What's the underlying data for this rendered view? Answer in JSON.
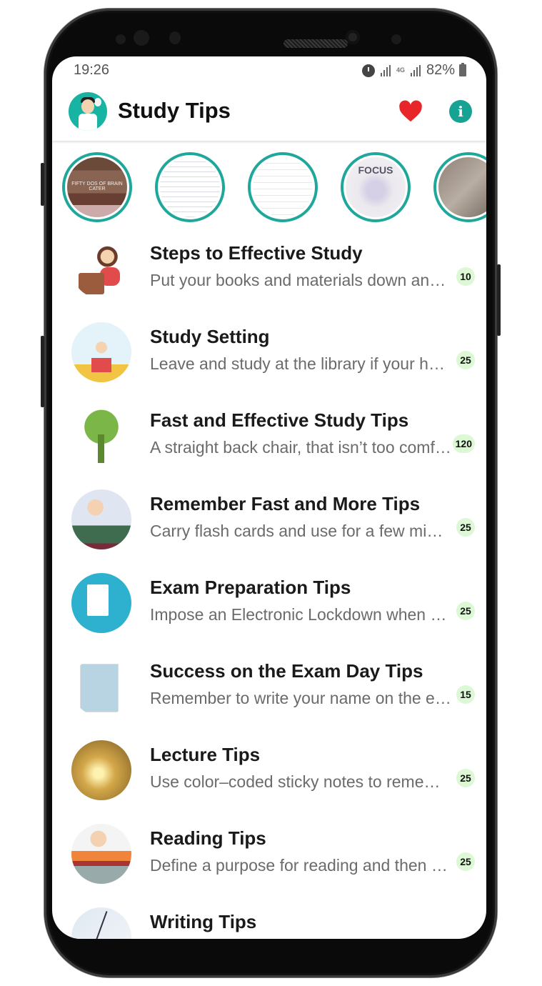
{
  "status_bar": {
    "time": "19:26",
    "network_label": "4G",
    "battery_percent": "82%",
    "icons": [
      "alarm-icon",
      "signal-icon",
      "4g-icon",
      "signal-icon",
      "battery-charging-icon"
    ]
  },
  "app_bar": {
    "title": "Study Tips",
    "actions": [
      {
        "name": "favorites",
        "icon": "heart-icon",
        "color": "#e8262a"
      },
      {
        "name": "info",
        "icon": "info-icon",
        "glyph": "i",
        "color": "#16a394"
      }
    ]
  },
  "stories": [
    {
      "caption": "FIFTY DOS OF BRAIN CATER"
    },
    {
      "caption": ""
    },
    {
      "caption": ""
    },
    {
      "caption": "FOCUS"
    },
    {
      "caption": ""
    }
  ],
  "accent_color": "#1fa79b",
  "badge_color": "#dcf8d4",
  "items": [
    {
      "title": "Steps to Effective Study",
      "subtitle": "Put your books and materials down and settle in",
      "count": "10"
    },
    {
      "title": "Study Setting",
      "subtitle": "Leave and study at the library if your home is noisy",
      "count": "25"
    },
    {
      "title": "Fast and Effective Study Tips",
      "subtitle": "A straight back chair, that isn’t too comfortable",
      "count": "120"
    },
    {
      "title": "Remember Fast and More Tips",
      "subtitle": "Carry flash cards and use for a few minutes",
      "count": "25"
    },
    {
      "title": "Exam Preparation Tips",
      "subtitle": "Impose an Electronic Lockdown when studying",
      "count": "25"
    },
    {
      "title": "Success on the Exam Day Tips",
      "subtitle": "Remember to write your name on the exam paper",
      "count": "15"
    },
    {
      "title": "Lecture Tips",
      "subtitle": "Use color–coded sticky notes to remember",
      "count": "25"
    },
    {
      "title": "Reading Tips",
      "subtitle": "Define a purpose for reading and then read",
      "count": "25"
    },
    {
      "title": "Writing Tips",
      "subtitle": "",
      "count": ""
    }
  ]
}
